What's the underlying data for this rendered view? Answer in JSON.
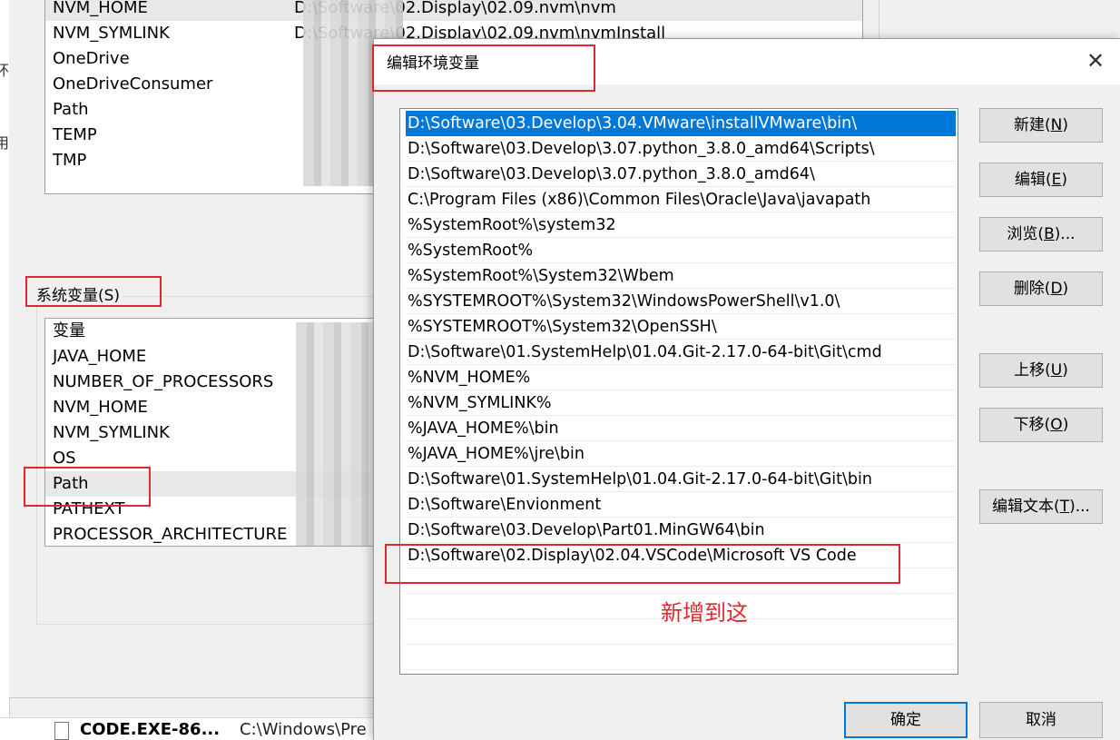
{
  "background_strip": {
    "chars": [
      "环",
      "用"
    ]
  },
  "taskbar": {
    "file_name": "CODE.EXE-86...",
    "file_path": "C:\\Windows\\Pre"
  },
  "env_dialog": {
    "user_vars": [
      {
        "name": "NVM_HOME",
        "value": "D:\\Software\\02.Display\\02.09.nvm\\nvm"
      },
      {
        "name": "NVM_SYMLINK",
        "value": "D:\\Software\\02.Display\\02.09.nvm\\nvmInstall"
      },
      {
        "name": "OneDrive",
        "value": ""
      },
      {
        "name": "OneDriveConsumer",
        "value": ""
      },
      {
        "name": "Path",
        "value": ""
      },
      {
        "name": "TEMP",
        "value": ""
      },
      {
        "name": "TMP",
        "value": ""
      }
    ],
    "system_vars_label": "系统变量(S)",
    "system_vars": [
      {
        "name": "变量"
      },
      {
        "name": "JAVA_HOME"
      },
      {
        "name": "NUMBER_OF_PROCESSORS"
      },
      {
        "name": "NVM_HOME"
      },
      {
        "name": "NVM_SYMLINK"
      },
      {
        "name": "OS"
      },
      {
        "name": "Path"
      },
      {
        "name": "PATHEXT"
      },
      {
        "name": "PROCESSOR_ARCHITECTURE"
      }
    ]
  },
  "edit_dialog": {
    "title": "编辑环境变量",
    "close_glyph": "✕",
    "paths": [
      "D:\\Software\\03.Develop\\3.04.VMware\\installVMware\\bin\\",
      "D:\\Software\\03.Develop\\3.07.python_3.8.0_amd64\\Scripts\\",
      "D:\\Software\\03.Develop\\3.07.python_3.8.0_amd64\\",
      "C:\\Program Files (x86)\\Common Files\\Oracle\\Java\\javapath",
      "%SystemRoot%\\system32",
      "%SystemRoot%",
      "%SystemRoot%\\System32\\Wbem",
      "%SYSTEMROOT%\\System32\\WindowsPowerShell\\v1.0\\",
      "%SYSTEMROOT%\\System32\\OpenSSH\\",
      "D:\\Software\\01.SystemHelp\\01.04.Git-2.17.0-64-bit\\Git\\cmd",
      "%NVM_HOME%",
      "%NVM_SYMLINK%",
      "%JAVA_HOME%\\bin",
      "%JAVA_HOME%\\jre\\bin",
      "D:\\Software\\01.SystemHelp\\01.04.Git-2.17.0-64-bit\\Git\\bin",
      "D:\\Software\\Envionment",
      "D:\\Software\\03.Develop\\Part01.MinGW64\\bin",
      "D:\\Software\\02.Display\\02.04.VSCode\\Microsoft VS Code"
    ],
    "buttons": {
      "new": {
        "text": "新建(",
        "key": "N",
        "end": ")"
      },
      "edit": {
        "text": "编辑(",
        "key": "E",
        "end": ")"
      },
      "browse": {
        "text": "浏览(",
        "key": "B",
        "end": ")..."
      },
      "delete": {
        "text": "删除(",
        "key": "D",
        "end": ")"
      },
      "move_up": {
        "text": "上移(",
        "key": "U",
        "end": ")"
      },
      "move_down": {
        "text": "下移(",
        "key": "O",
        "end": ")"
      },
      "edit_text": {
        "text": "编辑文本(",
        "key": "T",
        "end": ")..."
      }
    },
    "ok_label": "确定",
    "cancel_label": "取消",
    "annotation": "新增到这"
  },
  "colors": {
    "highlight_red": "#e0282e",
    "selection_blue": "#0078d7"
  }
}
